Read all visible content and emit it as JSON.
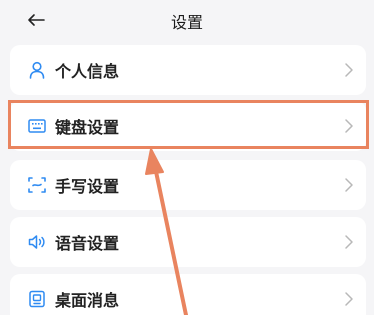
{
  "header": {
    "title": "设置",
    "back_icon": "arrow-left-icon"
  },
  "settings": {
    "items": [
      {
        "label": "个人信息",
        "icon": "person-icon"
      },
      {
        "label": "键盘设置",
        "icon": "keyboard-icon"
      },
      {
        "label": "手写设置",
        "icon": "handwriting-icon"
      },
      {
        "label": "语音设置",
        "icon": "speaker-icon"
      },
      {
        "label": "桌面消息",
        "icon": "desktop-message-icon"
      }
    ],
    "chevron_icon": "chevron-right-icon"
  },
  "annotation": {
    "highlighted_item": "键盘设置",
    "highlight_color": "#e9845f"
  },
  "colors": {
    "accent": "#2f8bf2",
    "background": "#f5f5f7",
    "card": "#ffffff",
    "chevron": "#b8b8b8"
  }
}
